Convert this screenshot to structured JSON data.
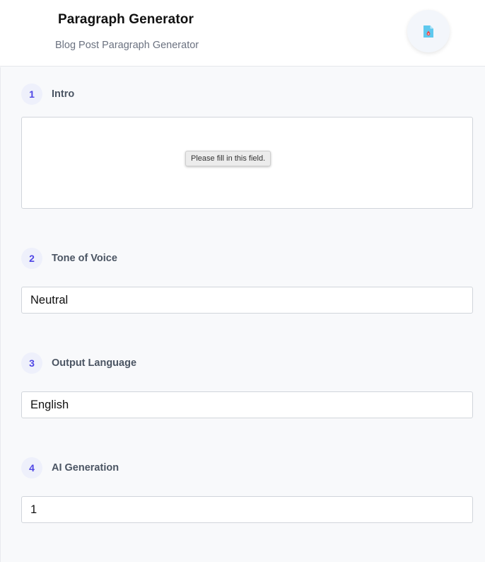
{
  "header": {
    "title": "Paragraph Generator",
    "subtitle": "Blog Post Paragraph Generator",
    "icon": "document-icon"
  },
  "steps": [
    {
      "number": "1",
      "label": "Intro",
      "tooltip": "Please fill in this field."
    },
    {
      "number": "2",
      "label": "Tone of Voice",
      "value": "Neutral"
    },
    {
      "number": "3",
      "label": "Output Language",
      "value": "English"
    },
    {
      "number": "4",
      "label": "AI Generation",
      "value": "1"
    }
  ]
}
